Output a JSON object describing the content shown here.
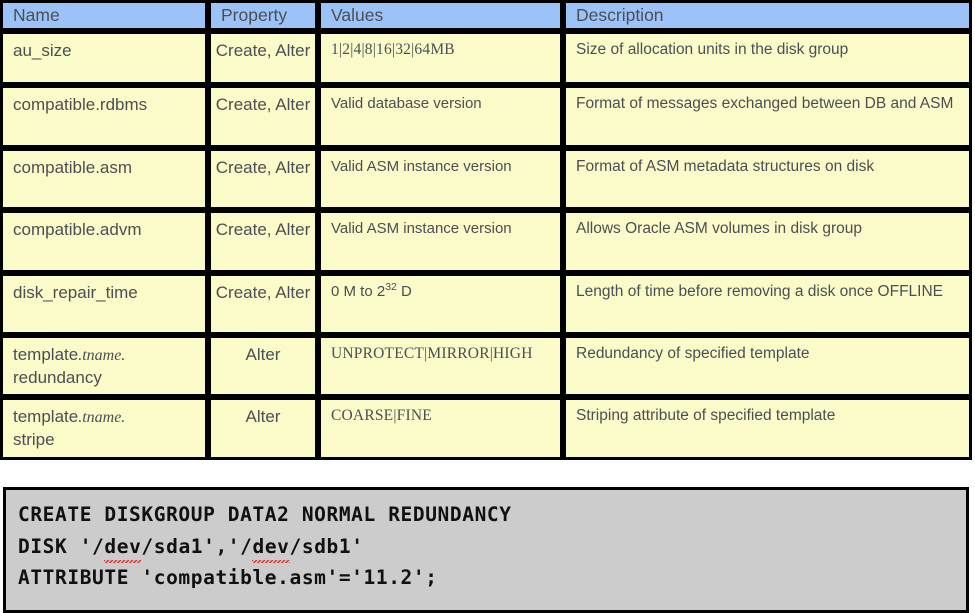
{
  "table": {
    "headers": [
      "Name",
      "Property",
      "Values",
      "Description"
    ],
    "header_bg": "#9CC3F8",
    "cell_bg": "#FBFAC9",
    "border_color": "#000000",
    "text_color": "#4B4F54",
    "rows": [
      {
        "name": "au_size",
        "property": "Create, Alter",
        "values": "1|2|4|8|16|32|64MB",
        "values_style": "mono",
        "description": "Size of allocation units in the disk group"
      },
      {
        "name": "compatible.rdbms",
        "property": "Create, Alter",
        "values": "Valid database version",
        "values_style": "sans",
        "description": "Format of messages exchanged between DB and ASM"
      },
      {
        "name": "compatible.asm",
        "property": "Create, Alter",
        "values": "Valid ASM instance version",
        "values_style": "sans",
        "description": "Format of ASM metadata structures on disk"
      },
      {
        "name": "compatible.advm",
        "property": "Create, Alter",
        "values": "Valid ASM instance version",
        "values_style": "sans",
        "description": "Allows Oracle ASM volumes in disk group"
      },
      {
        "name": "disk_repair_time",
        "property": "Create, Alter",
        "values": "0 M to 2^32 D",
        "values_style": "sans-superscript",
        "values_prefix": "0 M to 2",
        "values_superscript": "32",
        "values_suffix": " D",
        "description": "Length of time before removing a disk once OFFLINE"
      },
      {
        "name": "template.tname. redundancy",
        "name_prefix": "template",
        "name_italic": ".tname.",
        "name_suffix": "redundancy",
        "property": "Alter",
        "values": "UNPROTECT|MIRROR|HIGH",
        "values_style": "mono",
        "description": "Redundancy of specified template"
      },
      {
        "name": "template.tname. stripe",
        "name_prefix": "template",
        "name_italic": ".tname.",
        "name_suffix": "stripe",
        "property": "Alter",
        "values": "COARSE|FINE",
        "values_style": "mono",
        "description": "Striping attribute of specified template"
      }
    ]
  },
  "code_block": {
    "background": "#CCCCCC",
    "line1": "CREATE DISKGROUP DATA2 NORMAL REDUNDANCY",
    "line2_part1": "DISK '/",
    "line2_misspelled1": "dev",
    "line2_part2": "/sda1','/",
    "line2_misspelled2": "dev",
    "line2_part3": "/sdb1'",
    "line3": "ATTRIBUTE 'compatible.asm'='11.2';"
  }
}
